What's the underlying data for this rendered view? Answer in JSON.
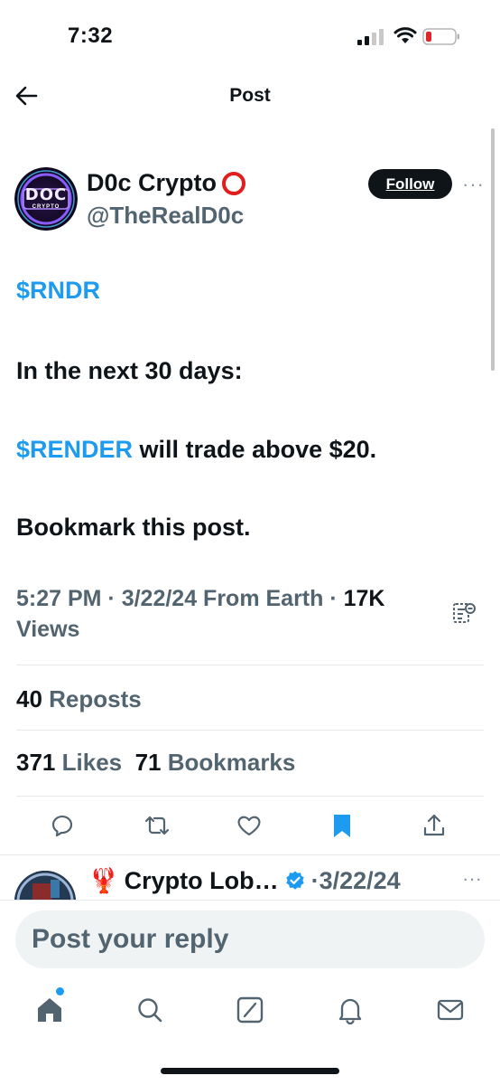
{
  "status_bar": {
    "time": "7:32",
    "signal_icon": "cellular-signal-icon",
    "wifi_icon": "wifi-icon",
    "battery_icon": "battery-low-icon"
  },
  "header": {
    "title": "Post",
    "back_icon": "back-arrow-icon"
  },
  "post": {
    "author_name": "D0c Crypto",
    "author_handle": "@TheRealD0c",
    "avatar_text": "DOC",
    "avatar_subtext": "CRYPTO",
    "follow_label": "Follow",
    "more_label": "···",
    "line1": "$RNDR",
    "line2": "In the next 30 days:",
    "line3_cashtag": "$RENDER",
    "line3_rest": " will trade above $20.",
    "line4": "Bookmark this post.",
    "timestamp": "5:27 PM · 3/22/24 From Earth · ",
    "views_count": "17K",
    "views_label": "Views"
  },
  "stats": {
    "reposts_count": "40",
    "reposts_label": "Reposts",
    "likes_count": "371",
    "likes_label": "Likes",
    "bookmarks_count": "71",
    "bookmarks_label": "Bookmarks"
  },
  "actions": [
    {
      "name": "reply-icon"
    },
    {
      "name": "repost-icon"
    },
    {
      "name": "like-icon"
    },
    {
      "name": "bookmark-filled-icon"
    },
    {
      "name": "share-icon"
    }
  ],
  "reply_preview": {
    "emoji": "🦞",
    "name": "Crypto Lob…",
    "date": "·3/22/24",
    "more_label": "···"
  },
  "reply_box": {
    "placeholder": "Post your reply"
  },
  "tabs": [
    {
      "name": "home-icon"
    },
    {
      "name": "search-icon"
    },
    {
      "name": "grok-icon"
    },
    {
      "name": "notifications-icon"
    },
    {
      "name": "messages-icon"
    }
  ],
  "colors": {
    "accent": "#1d9bf0",
    "text": "#0f1419",
    "secondary": "#536471",
    "ring": "#e11d1d"
  }
}
